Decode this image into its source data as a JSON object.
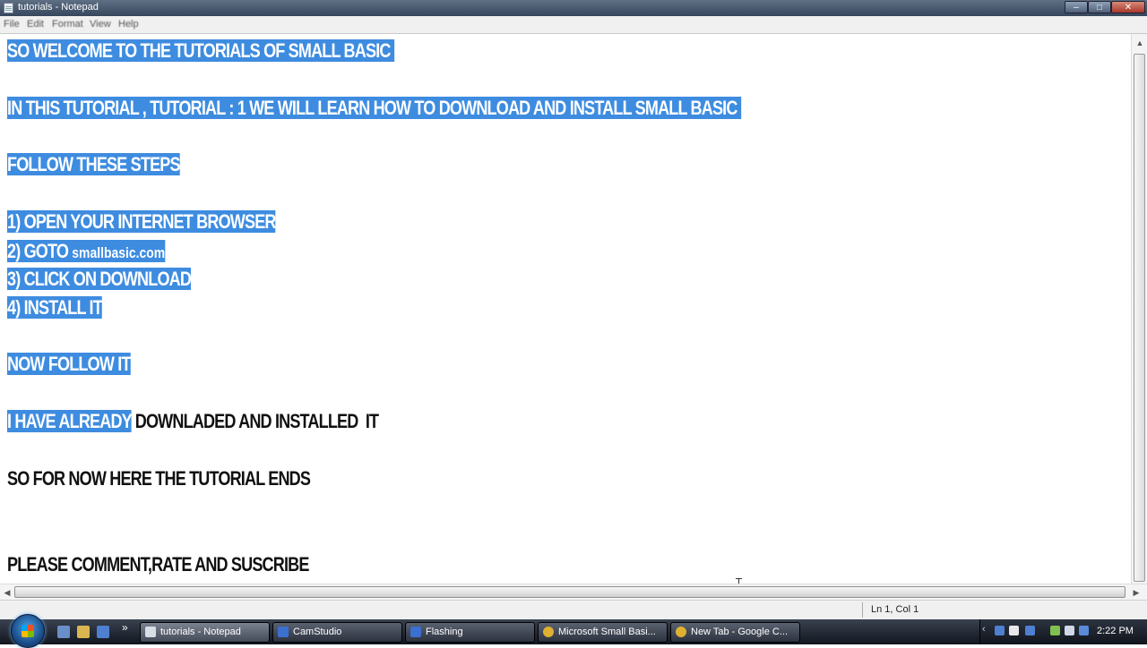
{
  "window": {
    "title": "tutorials - Notepad",
    "controls": {
      "minimize": "–",
      "maximize": "□",
      "close": "✕"
    }
  },
  "menu": [
    "File",
    "Edit",
    "Format",
    "View",
    "Help"
  ],
  "document": {
    "lines": [
      {
        "text": "SO WELCOME TO THE TUTORIALS OF SMALL BASIC ",
        "selected": true
      },
      {
        "text": "IN THIS TUTORIAL , TUTORIAL : 1 WE WILL LEARN HOW TO DOWNLOAD AND INSTALL SMALL BASIC ",
        "selected": true
      },
      {
        "text": "FOLLOW THESE STEPS",
        "selected": true
      },
      {
        "text": "1) OPEN YOUR INTERNET BROWSER",
        "selected": true
      },
      {
        "text": "2) GOTO ",
        "link": "smallbasic.com",
        "selected": true
      },
      {
        "text": "3) CLICK ON DOWNLOAD",
        "selected": true
      },
      {
        "text": "4) INSTALL IT",
        "selected": true
      },
      {
        "text": "NOW FOLLOW IT",
        "selected": true
      },
      {
        "text": "I HAVE ALREADY",
        "rest": " DOWNLADED AND INSTALLED  IT",
        "selected": "partial"
      },
      {
        "text": "SO FOR NOW HERE THE TUTORIAL ENDS",
        "selected": false
      },
      {
        "text": "PLEASE COMMENT,RATE AND SUSCRIBE",
        "selected": false
      }
    ]
  },
  "statusbar": {
    "position": "Ln 1, Col 1"
  },
  "taskbar": {
    "buttons": [
      {
        "label": "tutorials - Notepad",
        "icon_color": "#d8dde6",
        "active": true
      },
      {
        "label": "CamStudio",
        "icon_color": "#3b6fd0",
        "active": false
      },
      {
        "label": "Flashing",
        "icon_color": "#3b6fd0",
        "active": false
      },
      {
        "label": "Microsoft Small Basi...",
        "icon_color": "#e0b030",
        "active": false
      },
      {
        "label": "New Tab - Google C...",
        "icon_color": "#e0b030",
        "active": false
      }
    ],
    "quick_launch": [
      "show-desktop-icon",
      "folder-icon",
      "window-switch-icon"
    ],
    "tray_icons": [
      "network-icon",
      "volume-icon",
      "monitor-icon",
      "flag-icon",
      "shield-icon"
    ],
    "overflow": "»",
    "tray_expand": "‹",
    "clock": "2:22 PM"
  }
}
